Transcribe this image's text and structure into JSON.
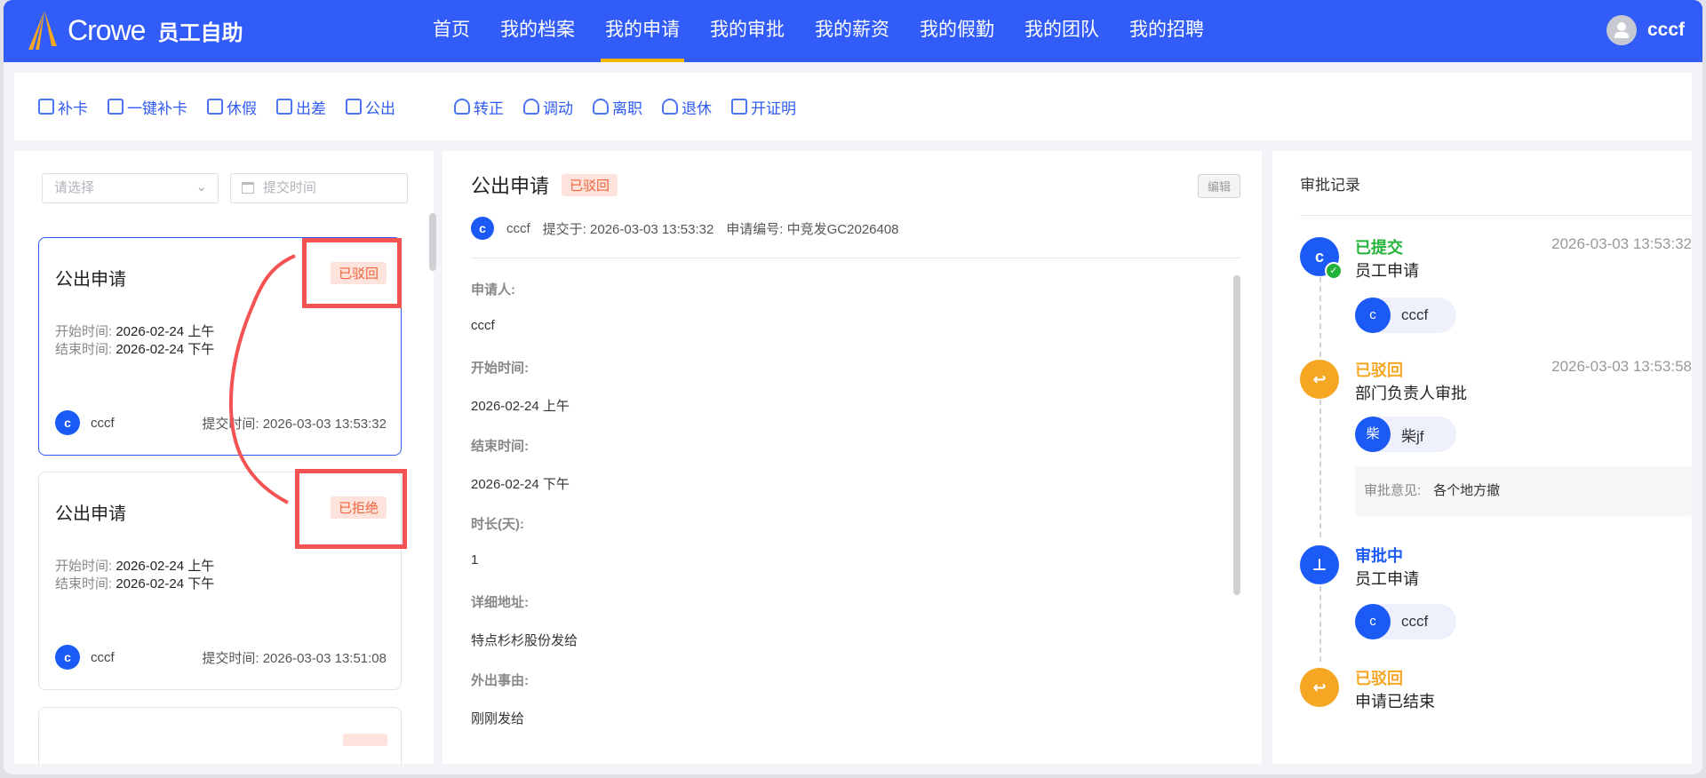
{
  "header": {
    "brand": "Crowe",
    "system": "员工自助",
    "nav": [
      "首页",
      "我的档案",
      "我的申请",
      "我的审批",
      "我的薪资",
      "我的假勤",
      "我的团队",
      "我的招聘"
    ],
    "active_nav": "我的申请",
    "user": "cccf"
  },
  "toolbar": {
    "items": [
      "补卡",
      "一键补卡",
      "休假",
      "出差",
      "公出"
    ],
    "items2": [
      "转正",
      "调动",
      "离职",
      "退休",
      "开证明"
    ]
  },
  "filters": {
    "status_placeholder": "请选择",
    "date_placeholder": "提交时间"
  },
  "list": [
    {
      "title": "公出申请",
      "status": "已驳回",
      "start_label": "开始时间:",
      "start": "2026-02-24 上午",
      "end_label": "结束时间:",
      "end": "2026-02-24 下午",
      "avatar": "c",
      "user": "cccf",
      "submit_label": "提交时间:",
      "submit": "2026-03-03 13:53:32"
    },
    {
      "title": "公出申请",
      "status": "已拒绝",
      "start_label": "开始时间:",
      "start": "2026-02-24 上午",
      "end_label": "结束时间:",
      "end": "2026-02-24 下午",
      "avatar": "c",
      "user": "cccf",
      "submit_label": "提交时间:",
      "submit": "2026-03-03 13:51:08"
    }
  ],
  "detail": {
    "title": "公出申请",
    "status": "已驳回",
    "edit": "编辑",
    "avatar": "c",
    "user": "cccf",
    "submitted": "提交于: 2026-03-03 13:53:32",
    "number": "申请编号: 中竞发GC2026408",
    "fields": [
      {
        "label": "申请人:",
        "value": "cccf"
      },
      {
        "label": "开始时间:",
        "value": "2026-02-24 上午"
      },
      {
        "label": "结束时间:",
        "value": "2026-02-24 下午"
      },
      {
        "label": "时长(天):",
        "value": "1"
      },
      {
        "label": "详细地址:",
        "value": "特点杉杉股份发给"
      },
      {
        "label": "外出事由:",
        "value": "刚刚发给"
      }
    ]
  },
  "records": {
    "title": "审批记录",
    "items": [
      {
        "status": "已提交",
        "color": "#22b33a",
        "time": "2026-03-03 13:53:32",
        "node": "员工申请",
        "avatar": "c",
        "user": "cccf"
      },
      {
        "status": "已驳回",
        "color": "#f5a623",
        "time": "2026-03-03 13:53:58",
        "node": "部门负责人审批",
        "avatar": "柴",
        "user": "柴jf",
        "opinion_label": "审批意见:",
        "opinion": "各个地方撤"
      },
      {
        "status": "审批中",
        "color": "#1c5af5",
        "node": "员工申请",
        "avatar": "c",
        "user": "cccf"
      },
      {
        "status": "已驳回",
        "color": "#f5a623",
        "node": "申请已结束"
      }
    ]
  },
  "colors": {
    "header": "#315cf8",
    "accent": "#1c5af5",
    "underline": "#f5b800",
    "reject_tag": "#f0643c",
    "annotation": "#f55253"
  }
}
